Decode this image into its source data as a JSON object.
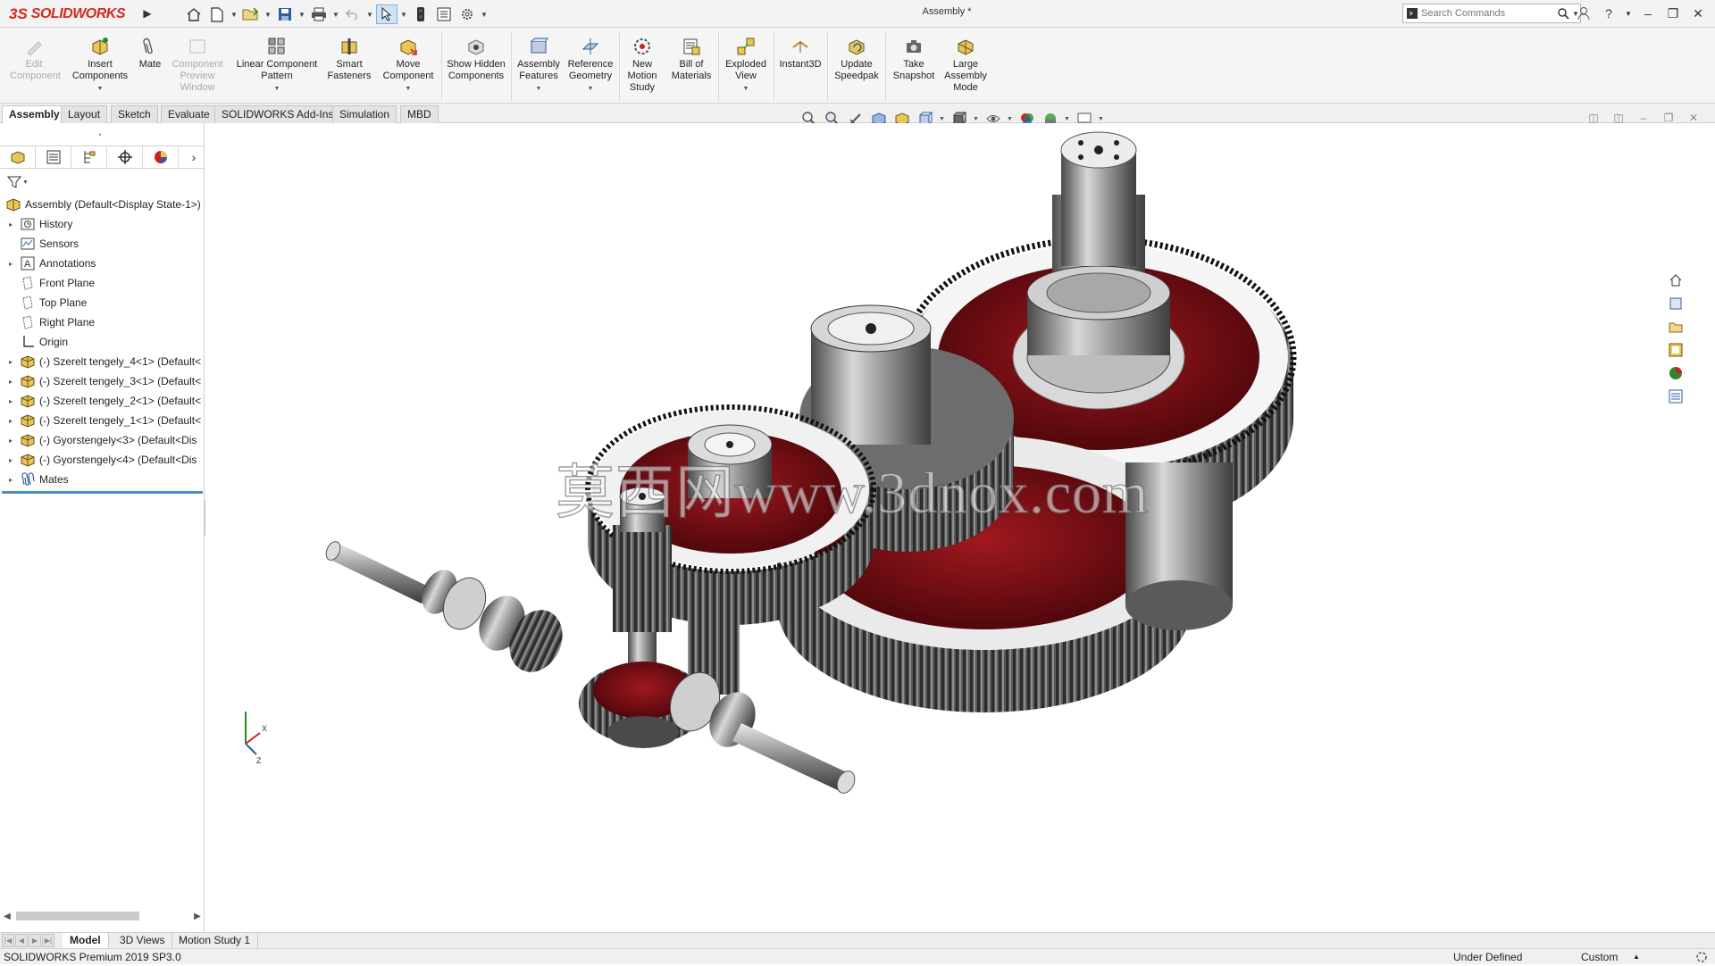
{
  "app": {
    "logo_ds": "3S",
    "logo_name": "SOLIDWORKS",
    "doc_title": "Assembly *"
  },
  "search": {
    "placeholder": "Search Commands"
  },
  "ribbon": {
    "edit_component": "Edit Component",
    "insert_components": "Insert Components",
    "mate": "Mate",
    "component_preview_window": "Component Preview Window",
    "linear_component_pattern": "Linear Component Pattern",
    "smart_fasteners": "Smart Fasteners",
    "move_component": "Move Component",
    "show_hidden_components": "Show Hidden Components",
    "assembly_features": "Assembly Features",
    "reference_geometry": "Reference Geometry",
    "new_motion_study": "New Motion Study",
    "bill_of_materials": "Bill of Materials",
    "exploded_view": "Exploded View",
    "instant3d": "Instant3D",
    "update_speedpak": "Update Speedpak",
    "take_snapshot": "Take Snapshot",
    "large_assembly_mode": "Large Assembly Mode"
  },
  "tabs": [
    "Assembly",
    "Layout",
    "Sketch",
    "Evaluate",
    "SOLIDWORKS Add-Ins",
    "Simulation",
    "MBD"
  ],
  "tree": {
    "root": "Assembly  (Default<Display State-1>)",
    "history": "History",
    "sensors": "Sensors",
    "annotations": "Annotations",
    "front_plane": "Front Plane",
    "top_plane": "Top Plane",
    "right_plane": "Right Plane",
    "origin": "Origin",
    "components": [
      "(-) Szerelt tengely_4<1> (Default<",
      "(-) Szerelt tengely_3<1> (Default<",
      "(-) Szerelt tengely_2<1> (Default<",
      "(-) Szerelt tengely_1<1> (Default<",
      "(-) Gyorstengely<3> (Default<Dis",
      "(-) Gyorstengely<4> (Default<Dis"
    ],
    "mates": "Mates"
  },
  "viewport": {
    "watermark": "莫西网www.3dnox.com",
    "triad_x": "X",
    "triad_z": "Z"
  },
  "bottom_tabs": [
    "Model",
    "3D Views",
    "Motion Study 1"
  ],
  "status": {
    "product": "SOLIDWORKS Premium 2019 SP3.0",
    "state": "Under Defined",
    "units": "Custom"
  },
  "colors": {
    "brand": "#d22a1e",
    "gear_red": "#7a0e12",
    "steel": "#8c8c8c",
    "accent": "#4a8ec9"
  }
}
